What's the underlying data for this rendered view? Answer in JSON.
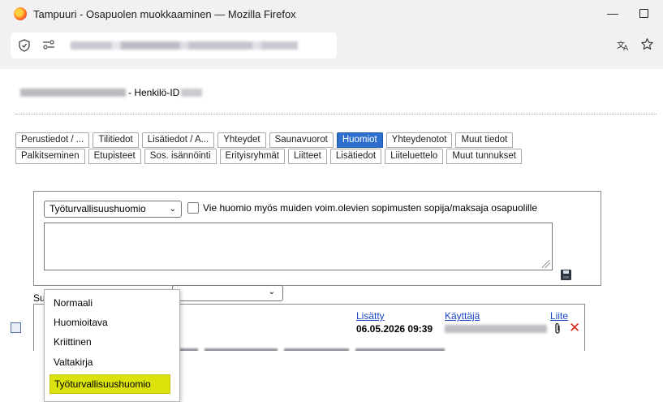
{
  "window": {
    "title": "Tampuuri - Osapuolen muokkaaminen — Mozilla Firefox",
    "minimize_symbol": "—"
  },
  "icons": {
    "app": "firefox-icon",
    "shield": "shield-icon",
    "permissions": "permissions-icon",
    "translate": "translate-icon",
    "bookmark": "star-icon",
    "save": "save-icon",
    "attachment": "paperclip-icon",
    "delete": "delete-icon"
  },
  "header": {
    "suffix": "- Henkilö-ID"
  },
  "tabs": {
    "row1": [
      "Perustiedot / ...",
      "Tilitiedot",
      "Lisätiedot / A...",
      "Yhteydet",
      "Saunavuorot",
      "Huomiot",
      "Yhteydenotot",
      "Muut tiedot"
    ],
    "row2": [
      "Palkitseminen",
      "Etupisteet",
      "Sos. isännöinti",
      "Erityisryhmät",
      "Liitteet",
      "Lisätiedot",
      "Liiteluettelo",
      "Muut tunnukset"
    ],
    "active": "Huomiot"
  },
  "form": {
    "type_select_value": "Työturvallisuushuomio",
    "checkbox_label": "Vie huomio myös muiden voim.olevien sopimusten sopija/maksaja osapuolille",
    "checkbox_checked": false
  },
  "dropdown": {
    "options": [
      "Normaali",
      "Huomioitava",
      "Kriittinen",
      "Valtakirja",
      "Työturvallisuushuomio"
    ],
    "selected": "Työturvallisuushuomio",
    "highlight_color": "#dce20c"
  },
  "list": {
    "label_prefix": "Su",
    "columns": {
      "added": "Lisätty",
      "user": "Käyttäjä",
      "attachment": "Liite"
    },
    "rows": [
      {
        "added": "06.05.2026 09:39"
      }
    ]
  },
  "colors": {
    "active_tab": "#2d6fcc",
    "link": "#1a45c2",
    "delete": "#d7261e"
  }
}
